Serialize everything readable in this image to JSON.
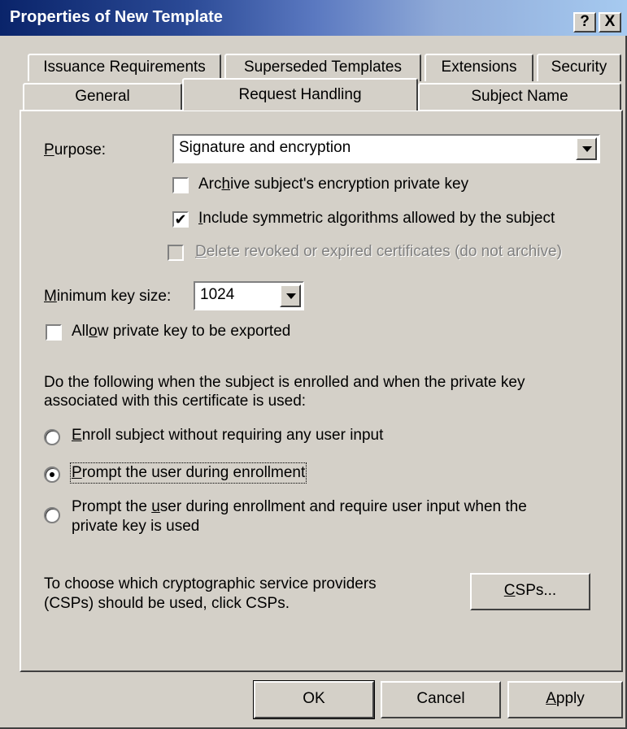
{
  "window": {
    "title": "Properties of New Template",
    "help_button": "?",
    "close_button": "X"
  },
  "tabs": {
    "row_back": [
      "Issuance Requirements",
      "Superseded Templates",
      "Extensions",
      "Security"
    ],
    "row_front": [
      "General",
      "Request Handling",
      "Subject Name"
    ],
    "active": "Request Handling"
  },
  "request_handling": {
    "purpose": {
      "label_prefix": "",
      "label_accel": "P",
      "label_rest": "urpose:",
      "value": "Signature and encryption"
    },
    "checkboxes": [
      {
        "pre": "Arc",
        "accel": "h",
        "post": "ive subject's encryption private key",
        "checked": false,
        "disabled": false
      },
      {
        "pre": "",
        "accel": "I",
        "post": "nclude symmetric algorithms allowed by the subject",
        "checked": true,
        "disabled": false
      },
      {
        "pre": "",
        "accel": "D",
        "post": "elete revoked or expired certificates (do not archive)",
        "checked": false,
        "disabled": true
      }
    ],
    "min_key_size": {
      "label_accel": "M",
      "label_rest": "inimum key size:",
      "value": "1024"
    },
    "allow_export": {
      "pre": "All",
      "accel": "o",
      "post": "w private key to be exported",
      "checked": false
    },
    "enroll_description_line1": "Do the following when the subject is enrolled and when the private key",
    "enroll_description_line2": "associated with this certificate is used:",
    "radios": [
      {
        "pre": "",
        "accel": "E",
        "post": "nroll subject without requiring any user input",
        "selected": false
      },
      {
        "pre": "",
        "accel": "P",
        "post": "rompt the user during enrollment",
        "selected": true
      },
      {
        "pre": "Prompt the ",
        "accel": "u",
        "post": "ser during enrollment and require user input when the",
        "line2": "private key is used",
        "selected": false
      }
    ],
    "csp_text_line1": "To choose which cryptographic service providers",
    "csp_text_line2": "(CSPs) should be used, click CSPs.",
    "csp_button": {
      "accel": "C",
      "rest": "SPs..."
    }
  },
  "footer": {
    "ok": "OK",
    "cancel": "Cancel",
    "apply_accel": "A",
    "apply_rest": "pply"
  }
}
